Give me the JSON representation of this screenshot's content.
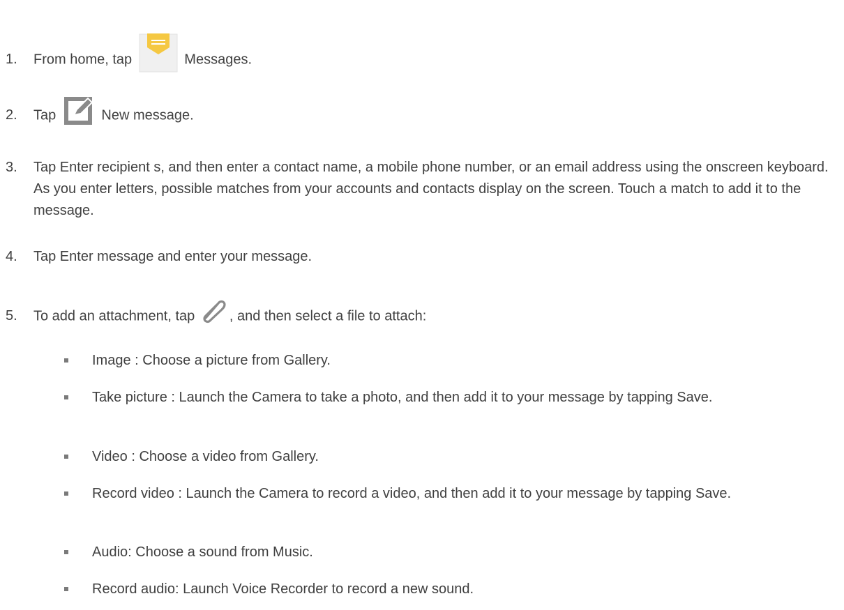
{
  "steps": [
    {
      "num": "1.",
      "before_icon": "From home, tap",
      "icon": "messages-app-icon",
      "after_icon": "Messages."
    },
    {
      "num": "2.",
      "before_icon": "Tap",
      "icon": "compose-icon",
      "after_icon": "New message."
    },
    {
      "num": "3.",
      "text": "Tap Enter recipient  s, and then enter a contact name, a mobile phone number, or an email address using the onscreen keyboard. As you enter letters, possible matches from your accounts and contacts display on the screen. Touch a match to add it to the message."
    },
    {
      "num": "4.",
      "text": "Tap Enter message  and enter your message."
    },
    {
      "num": "5.",
      "before_icon": "To add an attachment, tap",
      "icon": "paperclip-icon",
      "after_icon": ", and then select a file to attach:"
    }
  ],
  "attachments": [
    {
      "text": "Image : Choose a picture from Gallery."
    },
    {
      "text": "Take picture : Launch the Camera to take a photo, and then add it to your message by tapping Save."
    },
    {
      "text": "Video : Choose a video from Gallery."
    },
    {
      "text": "Record  video : Launch the Camera to record a video, and then add it to your message by tapping Save."
    },
    {
      "text": "Audio: Choose a sound  from Music."
    },
    {
      "text": "Record audio: Launch Voice Recorder to record a new sound."
    }
  ],
  "colors": {
    "text": "#404040",
    "messages_icon_top": "#f5c842",
    "messages_icon_body": "#eeeeee",
    "compose_icon": "#8a8a8a",
    "bullet": "#7a7a7a"
  }
}
